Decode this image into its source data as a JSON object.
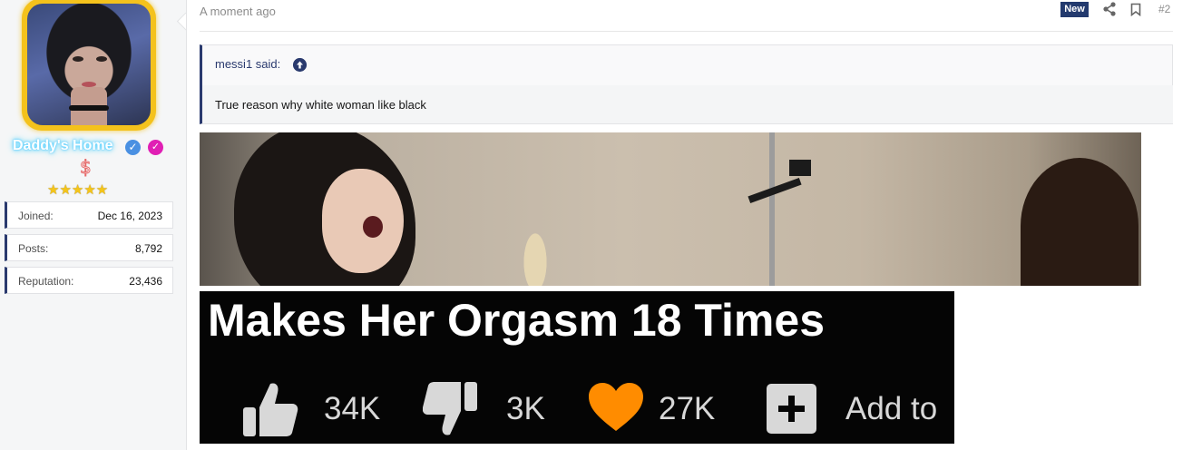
{
  "author": {
    "username": "Daddy's Home",
    "dollar": "$",
    "stars": "★★★★★",
    "stats": [
      {
        "label": "Joined:",
        "value": "Dec 16, 2023"
      },
      {
        "label": "Posts:",
        "value": "8,792"
      },
      {
        "label": "Reputation:",
        "value": "23,436"
      }
    ]
  },
  "post": {
    "time": "A moment ago",
    "new_badge": "New",
    "number": "#2",
    "quote": {
      "author_line": "messi1 said:",
      "text": "True reason why white woman like black"
    },
    "banner": {
      "title": "Makes Her Orgasm 18 Times",
      "likes": "34K",
      "dislikes": "3K",
      "favorites": "27K",
      "add_label": "Add to"
    }
  },
  "colors": {
    "accent": "#2a3a6e",
    "avatar_border": "#f4c21c",
    "heart": "#ff8c00",
    "username_glow": "#5ed7ff"
  },
  "icons": [
    "verified-icon",
    "badge-icon",
    "share-icon",
    "bookmark-icon",
    "arrow-up-circle-icon",
    "thumbs-up-icon",
    "thumbs-down-icon",
    "heart-icon",
    "plus-square-icon"
  ]
}
